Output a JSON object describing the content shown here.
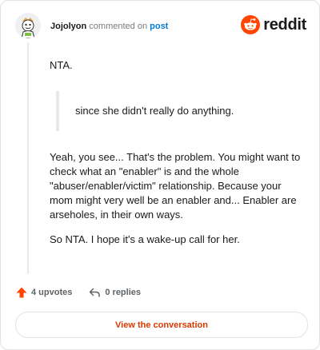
{
  "header": {
    "username": "Jojolyon",
    "verb": "commented on",
    "post_link": "post",
    "brand": "reddit"
  },
  "comment": {
    "paragraph_1": "NTA.",
    "quote": "since she didn't really do anything.",
    "paragraph_2": "Yeah, you see... That's the problem. You might want to check what an \"enabler\" is and the whole \"abuser/enabler/victim\" relationship. Because your mom might very well be an enabler and... Enabler are arseholes, in their own ways.",
    "paragraph_3": "So NTA. I hope it's a wake-up call for her."
  },
  "footer": {
    "upvotes_label": "4 upvotes",
    "replies_label": "0 replies",
    "view_conversation": "View the conversation"
  },
  "colors": {
    "brand": "#ff4500",
    "link": "#0079d3",
    "cta_text": "#d93a00",
    "muted": "#787c7e"
  }
}
